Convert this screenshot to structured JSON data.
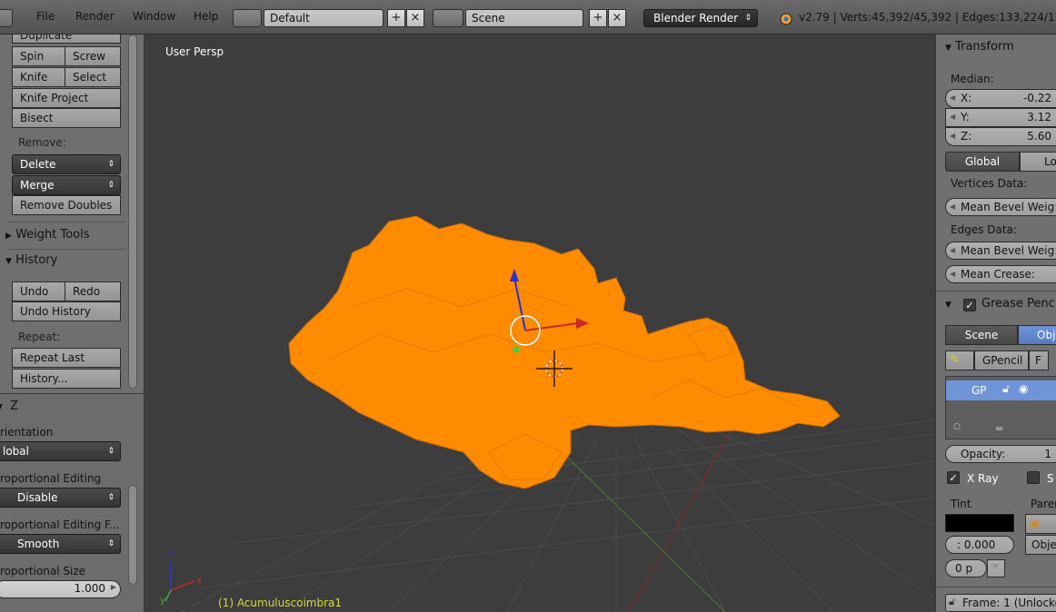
{
  "topbar": {
    "menu": [
      "File",
      "Render",
      "Window",
      "Help"
    ],
    "layout_name": "Default",
    "scene_name": "Scene",
    "renderer": "Blender Render",
    "info": "v2.79 | Verts:45,392/45,392 | Edges:133,224/13"
  },
  "tools": {
    "duplicate": "Duplicate",
    "spin": "Spin",
    "screw": "Screw",
    "knife": "Knife",
    "select": "Select",
    "knife_project": "Knife Project",
    "bisect": "Bisect",
    "remove_label": "Remove:",
    "delete": "Delete",
    "merge": "Merge",
    "remove_doubles": "Remove Doubles",
    "weight_tools": "Weight Tools",
    "history": "History",
    "undo": "Undo",
    "redo": "Redo",
    "undo_history": "Undo History",
    "repeat_label": "Repeat:",
    "repeat_last": "Repeat Last",
    "history_btn": "History..."
  },
  "operator": {
    "title": "Z",
    "orientation_label": "rientation",
    "orientation_value": "lobal",
    "prop_edit_label": "roportional Editing",
    "prop_edit_value": "Disable",
    "prop_falloff_label": "roportional Editing F...",
    "prop_falloff_value": "Smooth",
    "prop_size_label": "roportional Size",
    "prop_size_value": "1.000"
  },
  "viewport": {
    "view_label": "User Persp",
    "object_name": "(1) Acumuluscoimbra1",
    "axis_labels": {
      "x": "x",
      "y": "y",
      "z": "z"
    },
    "mesh_color": "#ff8c00",
    "grid_line": "#4a4a4a"
  },
  "properties": {
    "transform": "Transform",
    "median": "Median:",
    "x_label": "X:",
    "x_value": "-0.22",
    "y_label": "Y:",
    "y_value": "3.12",
    "z_label": "Z:",
    "z_value": "5.60",
    "global": "Global",
    "local": "Lo",
    "vertices_data": "Vertices Data:",
    "mean_bevel_v": "Mean Bevel Weig: (",
    "edges_data": "Edges Data:",
    "mean_bevel_e": "Mean Bevel Weig: (",
    "mean_crease": "Mean Crease:",
    "grease_pencil": "Grease Penci",
    "scene_tab": "Scene",
    "object_tab": "Obj",
    "gpencil": "GPencil",
    "f_btn": "F",
    "layer_gp": "GP",
    "opacity_label": "Opacity:",
    "opacity_value": "1",
    "xray": "X Ray",
    "s_label": "S",
    "tint": "Tint",
    "parent": "Parer",
    "tint_value": ": 0.000",
    "obje": "Obje",
    "px": "0 p",
    "frame": "Frame: 1 (Unlocke"
  }
}
